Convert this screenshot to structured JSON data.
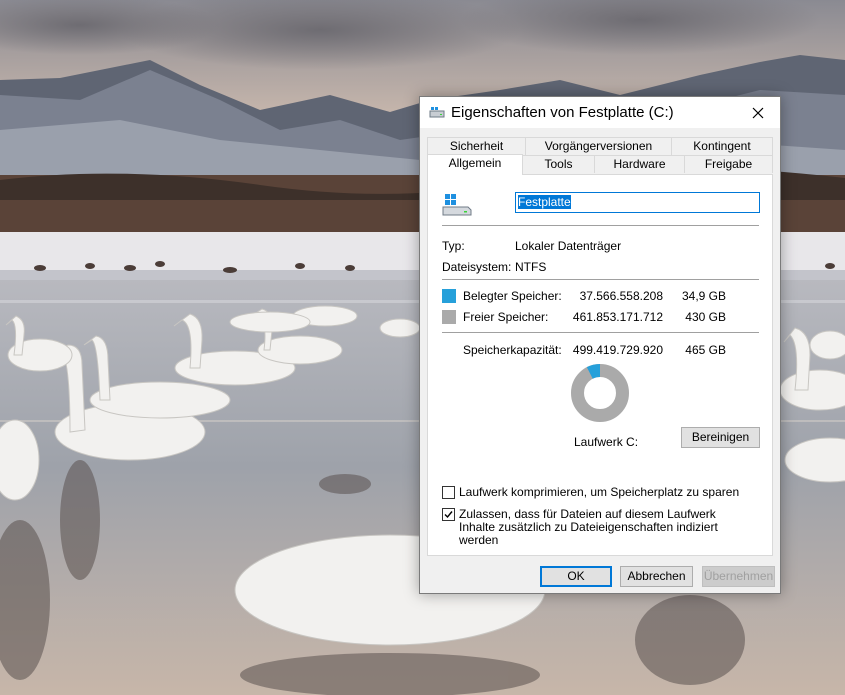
{
  "window": {
    "title": "Eigenschaften von Festplatte (C:)"
  },
  "tabs": {
    "row1": [
      "Sicherheit",
      "Vorgängerversionen",
      "Kontingent"
    ],
    "row2": [
      "Allgemein",
      "Tools",
      "Hardware",
      "Freigabe"
    ],
    "active": "Allgemein"
  },
  "general": {
    "drive_name": "Festplatte",
    "type_label": "Typ:",
    "type_value": "Lokaler Datenträger",
    "fs_label": "Dateisystem:",
    "fs_value": "NTFS",
    "used": {
      "label": "Belegter Speicher:",
      "bytes": "37.566.558.208",
      "size": "34,9 GB",
      "color": "#26a0da"
    },
    "free": {
      "label": "Freier Speicher:",
      "bytes": "461.853.171.712",
      "size": "430 GB",
      "color": "#aaaaaa"
    },
    "capacity": {
      "label": "Speicherkapazität:",
      "bytes": "499.419.729.920",
      "size": "465 GB"
    },
    "used_fraction": 0.075,
    "drive_label": "Laufwerk C:",
    "cleanup_button": "Bereinigen",
    "compress_label": "Laufwerk komprimieren, um Speicherplatz zu sparen",
    "compress_checked": false,
    "index_label": "Zulassen, dass für Dateien auf diesem Laufwerk Inhalte zusätzlich zu Dateieigenschaften indiziert werden",
    "index_checked": true
  },
  "footer": {
    "ok": "OK",
    "cancel": "Abbrechen",
    "apply": "Übernehmen"
  },
  "icons": {
    "title": "drive-icon",
    "drive": "windows-drive-icon",
    "close": "close-icon"
  },
  "colors": {
    "accent": "#0078d7"
  }
}
